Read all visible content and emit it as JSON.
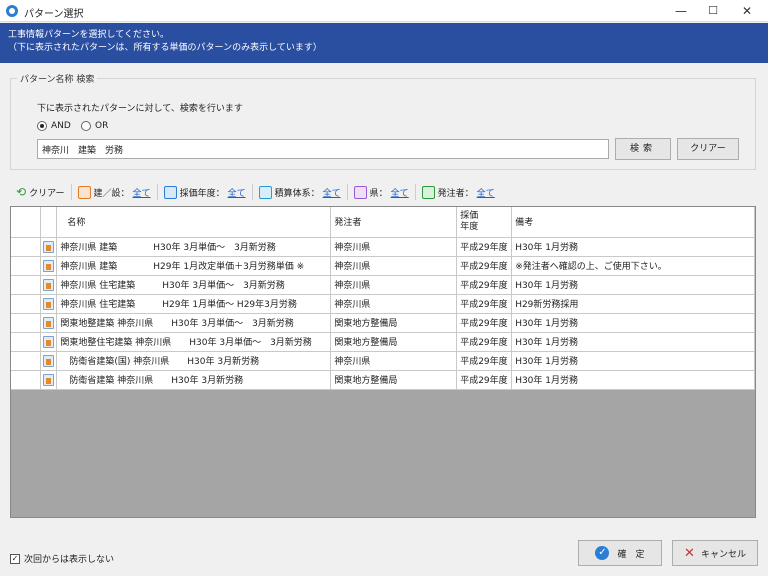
{
  "window": {
    "title": "パターン選択"
  },
  "banner": {
    "line1": "工事情報パターンを選択してください。",
    "line2": "（下に表示されたパターンは、所有する単価のパターンのみ表示しています）"
  },
  "search": {
    "group_title": "パターン名称 検索",
    "description": "下に表示されたパターンに対して、検索を行います",
    "and_label": "AND",
    "or_label": "OR",
    "query": "神奈川　建築　労務",
    "search_label": "検索",
    "clear_label": "クリアー"
  },
  "toolbar": {
    "clear_label": "クリアー",
    "filters": [
      {
        "label": "建／設：",
        "link": "全て",
        "color": "#e07b2a"
      },
      {
        "label": "採価年度：",
        "link": "全て",
        "color": "#2a7fd4"
      },
      {
        "label": "積算体系：",
        "link": "全て",
        "color": "#2a9ad4"
      },
      {
        "label": "県：",
        "link": "全て",
        "color": "#9a5ad4"
      },
      {
        "label": "発注者：",
        "link": "全て",
        "color": "#2a9a3a"
      }
    ]
  },
  "table": {
    "headers": [
      "名称",
      "発注者",
      "採価\n年度",
      "備考"
    ],
    "rows": [
      {
        "name": "神奈川県 建築　　　　H30年 3月単価～　3月新労務",
        "orderer": "神奈川県",
        "year": "平成29年度",
        "note": "H30年 1月労務"
      },
      {
        "name": "神奈川県 建築　　　　H29年 1月改定単価＋3月労務単価 ※",
        "orderer": "神奈川県",
        "year": "平成29年度",
        "note": "※発注者へ確認の上、ご使用下さい。"
      },
      {
        "name": "神奈川県 住宅建築　　　H30年 3月単価～　3月新労務",
        "orderer": "神奈川県",
        "year": "平成29年度",
        "note": "H30年 1月労務"
      },
      {
        "name": "神奈川県 住宅建築　　　H29年 1月単価～ H29年3月労務",
        "orderer": "神奈川県",
        "year": "平成29年度",
        "note": "H29新労務採用"
      },
      {
        "name": "関東地整建築 神奈川県　　H30年 3月単価～　3月新労務",
        "orderer": "関東地方整備局",
        "year": "平成29年度",
        "note": "H30年 1月労務"
      },
      {
        "name": "関東地整住宅建築 神奈川県　　H30年 3月単価～　3月新労務",
        "orderer": "関東地方整備局",
        "year": "平成29年度",
        "note": "H30年 1月労務"
      },
      {
        "name": "　防衛省建築(国) 神奈川県　　H30年 3月新労務",
        "orderer": "神奈川県",
        "year": "平成29年度",
        "note": "H30年 1月労務"
      },
      {
        "name": "　防衛省建築 神奈川県　　H30年 3月新労務",
        "orderer": "関東地方整備局",
        "year": "平成29年度",
        "note": "H30年 1月労務"
      }
    ]
  },
  "footer": {
    "dont_show_label": "次回からは表示しない",
    "ok_label": "確　定",
    "cancel_label": "キャンセル"
  }
}
